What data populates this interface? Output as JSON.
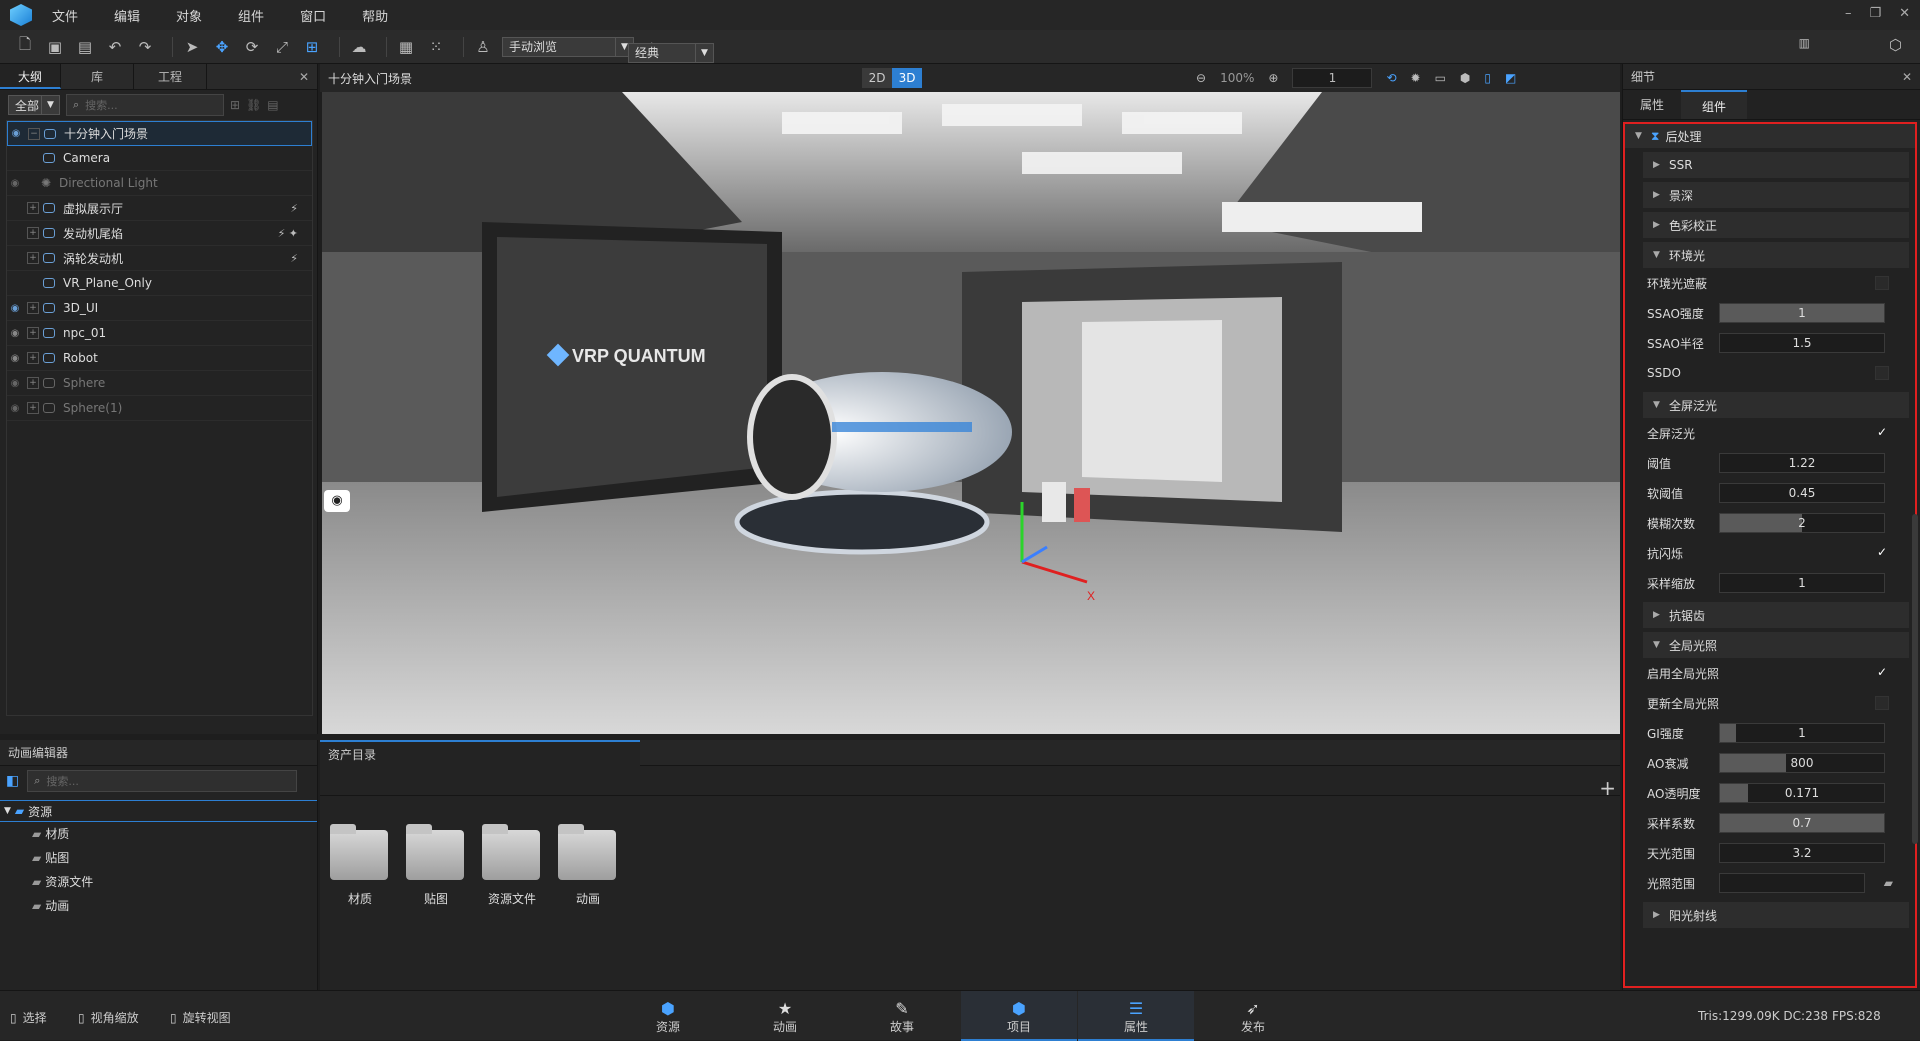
{
  "menu": {
    "items": [
      "文件",
      "编辑",
      "对象",
      "组件",
      "窗口",
      "帮助"
    ]
  },
  "toolbar": {
    "browse_mode": "手动浏览",
    "layout_mode": "经典"
  },
  "outline": {
    "tabs": [
      "大纲",
      "库",
      "工程"
    ],
    "filter": "全部",
    "search_placeholder": "搜索...",
    "items": [
      {
        "label": "十分钟入门场景",
        "visible": true
      },
      {
        "label": "Camera"
      },
      {
        "label": "Directional Light"
      },
      {
        "label": "虚拟展示厅"
      },
      {
        "label": "发动机尾焰"
      },
      {
        "label": "涡轮发动机"
      },
      {
        "label": "VR_Plane_Only"
      },
      {
        "label": "3D_UI"
      },
      {
        "label": "npc_01"
      },
      {
        "label": "Robot"
      },
      {
        "label": "Sphere"
      },
      {
        "label": "Sphere(1)"
      }
    ]
  },
  "viewport": {
    "title": "十分钟入门场景",
    "mode_2d": "2D",
    "mode_3d": "3D",
    "zoom": "100%",
    "frame": "1",
    "screen_text": "VRP QUANTUM",
    "axis_x": "X"
  },
  "anim_editor": {
    "title": "动画编辑器",
    "search_placeholder": "搜索...",
    "tree": [
      "资源",
      "材质",
      "贴图",
      "资源文件",
      "动画"
    ]
  },
  "assets": {
    "title": "资产目录",
    "folders": [
      "材质",
      "贴图",
      "资源文件",
      "动画"
    ]
  },
  "details": {
    "title": "细节",
    "tabs": [
      "属性",
      "组件"
    ],
    "root": "后处理",
    "ssr": "SSR",
    "dof": "景深",
    "color": "色彩校正",
    "ambient": {
      "label": "环境光",
      "ao_label": "环境光遮蔽",
      "ssao_strength_label": "SSAO强度",
      "ssao_strength": "1",
      "ssao_radius_label": "SSAO半径",
      "ssao_radius": "1.5",
      "ssdo_label": "SSDO"
    },
    "bloom": {
      "label": "全屏泛光",
      "enable_label": "全屏泛光",
      "threshold_label": "阈值",
      "threshold": "1.22",
      "soft_label": "软阈值",
      "soft": "0.45",
      "blur_label": "模糊次数",
      "blur": "2",
      "flicker_label": "抗闪烁",
      "scale_label": "采样缩放",
      "scale": "1"
    },
    "aa": "抗锯齿",
    "gi": {
      "label": "全局光照",
      "enable_label": "启用全局光照",
      "update_label": "更新全局光照",
      "strength_label": "GI强度",
      "strength": "1",
      "ao_decay_label": "AO衰减",
      "ao_decay": "800",
      "ao_alpha_label": "AO透明度",
      "ao_alpha": "0.171",
      "sample_label": "采样系数",
      "sample": "0.7",
      "sky_label": "天光范围",
      "sky": "3.2",
      "light_label": "光照范围"
    },
    "sunray": "阳光射线"
  },
  "status": {
    "tools": [
      "选择",
      "视角缩放",
      "旋转视图"
    ],
    "nav": [
      "资源",
      "动画",
      "故事",
      "项目",
      "属性",
      "发布"
    ],
    "stats": "Tris:1299.09K  DC:238",
    "fps": "FPS:828"
  }
}
